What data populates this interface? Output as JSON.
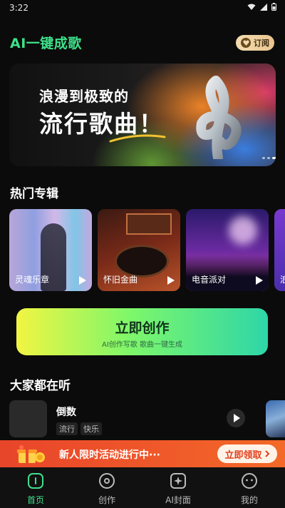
{
  "status_bar": {
    "time": "3:22"
  },
  "header": {
    "title": "AI一键成歌",
    "subscribe_label": "订阅"
  },
  "banner": {
    "line1": "浪漫到极致的",
    "line2": "流行歌曲！"
  },
  "hot_albums": {
    "title": "热门专辑",
    "items": [
      {
        "name": "灵魂乐章"
      },
      {
        "name": "怀旧金曲"
      },
      {
        "name": "电音派对"
      },
      {
        "name": "浪"
      }
    ]
  },
  "create": {
    "title": "立即创作",
    "subtitle": "AI创作写歌 歌曲一键生成"
  },
  "everyone": {
    "title": "大家都在听",
    "song": {
      "title": "倒数",
      "tags": [
        "流行",
        "快乐"
      ]
    }
  },
  "promo": {
    "text": "新人限时活动进行中···",
    "button": "立即领取"
  },
  "tabs": [
    {
      "label": "首页",
      "icon": "home-icon",
      "active": true
    },
    {
      "label": "创作",
      "icon": "disc-icon",
      "active": false
    },
    {
      "label": "AI封面",
      "icon": "image-icon",
      "active": false
    },
    {
      "label": "我的",
      "icon": "profile-icon",
      "active": false
    }
  ],
  "colors": {
    "accent": "#3ee08a",
    "promo": "#f05a2a"
  }
}
